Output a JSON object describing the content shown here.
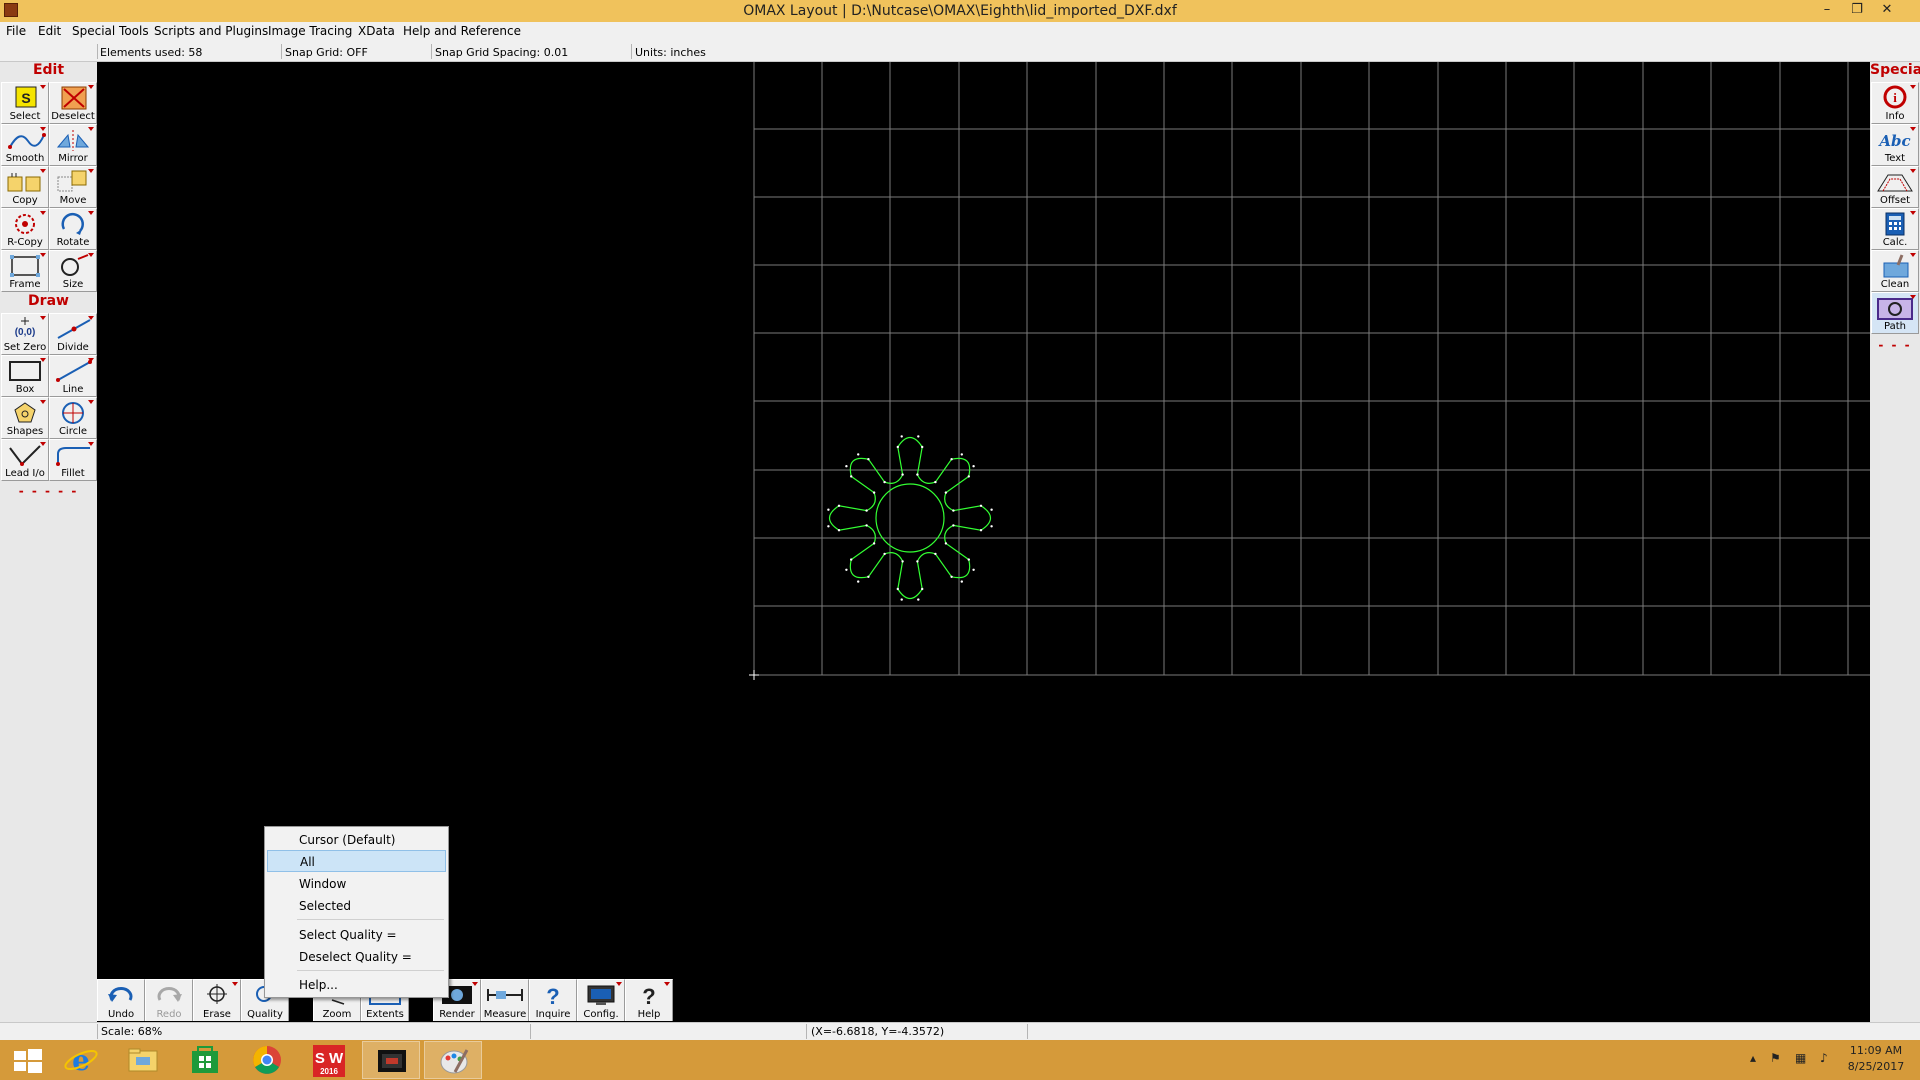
{
  "window": {
    "title": "OMAX Layout | D:\\Nutcase\\OMAX\\Eighth\\lid_imported_DXF.dxf",
    "controls": [
      "–",
      "❐",
      "✕"
    ]
  },
  "menu": [
    "File",
    "Edit",
    "Special Tools",
    "Scripts and Plugins",
    "Image Tracing",
    "XData",
    "Help and Reference"
  ],
  "info": {
    "elements_used": "Elements used: 58",
    "snap_grid": "Snap Grid: OFF",
    "snap_spacing": "Snap Grid Spacing: 0.01",
    "units": "Units: inches"
  },
  "left_panel": {
    "edit_title": "Edit",
    "edit_tools": [
      {
        "label": "Select",
        "icon": "select-icon"
      },
      {
        "label": "Deselect",
        "icon": "deselect-icon"
      },
      {
        "label": "Smooth",
        "icon": "smooth-icon"
      },
      {
        "label": "Mirror",
        "icon": "mirror-icon"
      },
      {
        "label": "Copy",
        "icon": "copy-icon"
      },
      {
        "label": "Move",
        "icon": "move-icon"
      },
      {
        "label": "R-Copy",
        "icon": "rotary-copy-icon"
      },
      {
        "label": "Rotate",
        "icon": "rotate-icon"
      },
      {
        "label": "Frame",
        "icon": "frame-icon"
      },
      {
        "label": "Size",
        "icon": "size-icon"
      }
    ],
    "draw_title": "Draw",
    "draw_tools": [
      {
        "label": "Set Zero",
        "icon": "set-zero-icon",
        "glyph": "(0,0)"
      },
      {
        "label": "Divide",
        "icon": "divide-icon"
      },
      {
        "label": "Box",
        "icon": "box-icon"
      },
      {
        "label": "Line",
        "icon": "line-icon"
      },
      {
        "label": "Shapes",
        "icon": "shapes-icon"
      },
      {
        "label": "Circle",
        "icon": "circle-icon"
      },
      {
        "label": "Lead I/o",
        "icon": "lead-io-icon"
      },
      {
        "label": "Fillet",
        "icon": "fillet-icon"
      }
    ],
    "more": "- - - - -"
  },
  "right_panel": {
    "title": "Special",
    "tools": [
      {
        "label": "Info",
        "icon": "info-icon"
      },
      {
        "label": "Text",
        "icon": "text-icon",
        "glyph": "Abc"
      },
      {
        "label": "Offset",
        "icon": "offset-icon"
      },
      {
        "label": "Calc.",
        "icon": "calculator-icon"
      },
      {
        "label": "Clean",
        "icon": "clean-icon"
      },
      {
        "label": "Path",
        "icon": "path-icon"
      }
    ],
    "more": "- - -"
  },
  "bottom_toolbar": [
    {
      "label": "Undo",
      "icon": "undo-icon",
      "enabled": true
    },
    {
      "label": "Redo",
      "icon": "redo-icon",
      "enabled": false
    },
    {
      "label": "Erase",
      "icon": "erase-icon",
      "enabled": true
    },
    {
      "label": "Quality",
      "icon": "quality-icon",
      "enabled": true
    },
    {
      "label": "Zoom",
      "icon": "zoom-icon",
      "enabled": true
    },
    {
      "label": "Extents",
      "icon": "extents-icon",
      "enabled": true
    },
    {
      "label": "Render",
      "icon": "render-icon",
      "enabled": true
    },
    {
      "label": "Measure",
      "icon": "measure-icon",
      "enabled": true
    },
    {
      "label": "Inquire",
      "icon": "inquire-icon",
      "enabled": true
    },
    {
      "label": "Config.",
      "icon": "config-icon",
      "enabled": true
    },
    {
      "label": "Help",
      "icon": "help-icon",
      "enabled": true
    }
  ],
  "context_menu": {
    "items": [
      "Cursor (Default)",
      "All",
      "Window",
      "Selected",
      "Select Quality =",
      "Deselect Quality =",
      "Help..."
    ],
    "highlighted": "All"
  },
  "status": {
    "scale": "Scale: 68%",
    "coords": "(X=-6.6818, Y=-4.3572)"
  },
  "taskbar": {
    "apps": [
      "windows-start-icon",
      "internet-explorer-icon",
      "file-explorer-icon",
      "store-icon",
      "chrome-icon",
      "solidworks-icon",
      "omax-layout-icon",
      "paint-icon"
    ],
    "solidworks_text": "S W",
    "solidworks_year": "2016",
    "time": "11:09 AM",
    "date": "8/25/2017"
  },
  "colors": {
    "title_bar": "#f0c25c",
    "taskbar": "#d59a3a",
    "grid": "#7a7a7a",
    "geometry": "#33ff33",
    "panel_heading": "#c00000"
  }
}
